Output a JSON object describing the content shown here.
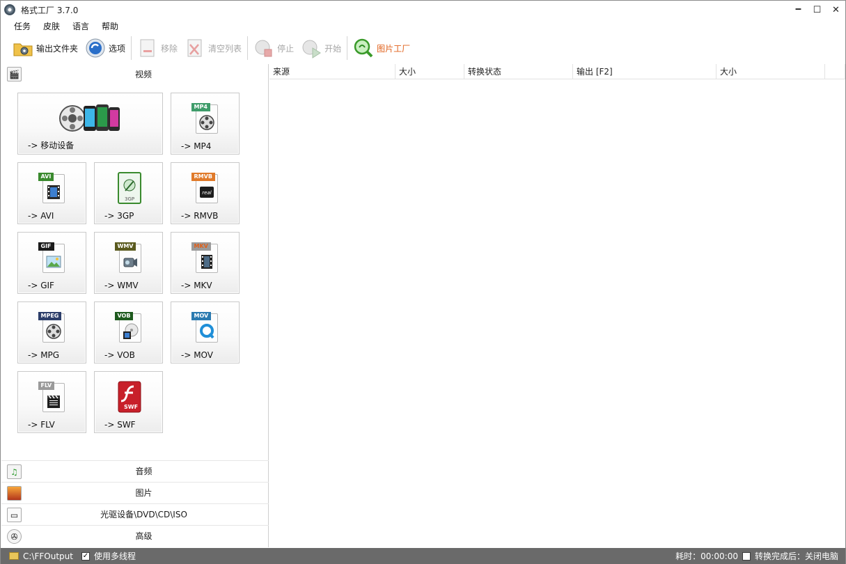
{
  "window": {
    "title": "格式工厂 3.7.0",
    "minimize": "🗕",
    "maximize": "☐",
    "close": "✕"
  },
  "menu": [
    "任务",
    "皮肤",
    "语言",
    "帮助"
  ],
  "toolbar": {
    "output_folder": "输出文件夹",
    "options": "选项",
    "remove": "移除",
    "clear_list": "清空列表",
    "stop": "停止",
    "start": "开始",
    "picture_factory": "图片工厂"
  },
  "left": {
    "video_header": "视频",
    "tiles": [
      {
        "label": "-> 移动设备",
        "tag": ""
      },
      {
        "label": "-> MP4",
        "tag": "MP4",
        "tag_color": "#3e9c6a"
      },
      {
        "label": "-> AVI",
        "tag": "AVI",
        "tag_color": "#3a8a2e"
      },
      {
        "label": "-> 3GP",
        "tag": "",
        "sub": "3GP"
      },
      {
        "label": "-> RMVB",
        "tag": "RMVB",
        "tag_color": "#e07a2a"
      },
      {
        "label": "-> GIF",
        "tag": "GIF",
        "tag_color": "#1b1b1b"
      },
      {
        "label": "-> WMV",
        "tag": "WMV",
        "tag_color": "#5a5a1e"
      },
      {
        "label": "-> MKV",
        "tag": "MKV",
        "tag_color": "#9a9a9a"
      },
      {
        "label": "-> MPG",
        "tag": "MPEG",
        "tag_color": "#2c3e6a"
      },
      {
        "label": "-> VOB",
        "tag": "VOB",
        "tag_color": "#1e5a1e"
      },
      {
        "label": "-> MOV",
        "tag": "MOV",
        "tag_color": "#2a7ab0"
      },
      {
        "label": "-> FLV",
        "tag": "FLV",
        "tag_color": "#9a9a9a"
      },
      {
        "label": "-> SWF",
        "tag": "",
        "sub": "SWF"
      }
    ],
    "audio_header": "音频",
    "picture_header": "图片",
    "disc_header": "光驱设备\\DVD\\CD\\ISO",
    "advanced_header": "高级"
  },
  "table": {
    "columns": [
      "来源",
      "大小",
      "转换状态",
      "输出 [F2]",
      "大小",
      ""
    ]
  },
  "status": {
    "output_path": "C:\\FFOutput",
    "multithread_label": "使用多线程",
    "multithread_checked": true,
    "elapsed": "耗时：00:00:00",
    "after_convert": "转换完成后：关闭电脑"
  },
  "colors": {
    "statusbar_bg": "#6a6a6a",
    "accent_orange": "#e0601a"
  }
}
